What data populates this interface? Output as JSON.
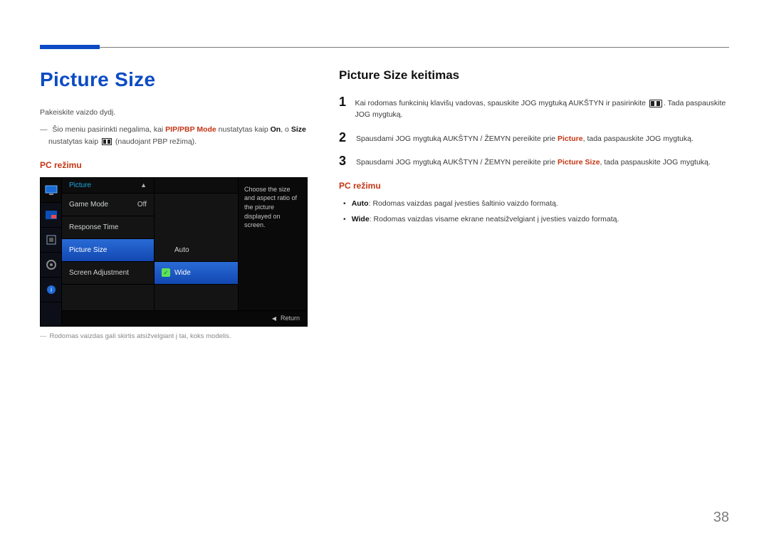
{
  "page_number": 38,
  "left": {
    "title": "Picture Size",
    "intro": "Pakeiskite vaizdo dydį.",
    "note_parts": {
      "a": "Šio meniu pasirinkti negalima, kai ",
      "b": "PIP/PBP Mode",
      "c": " nustatytas kaip ",
      "d": "On",
      "e": ", o ",
      "f": "Size",
      "g": " nustatytas kaip ",
      "h": " (naudojant PBP režimą)."
    },
    "pc_mode_label": "PC režimu",
    "footnote": "Rodomas vaizdas gali skirtis atsižvelgiant į tai, koks modelis."
  },
  "osd": {
    "header": "Picture",
    "rows": {
      "game_mode": {
        "label": "Game Mode",
        "value": "Off"
      },
      "response_time": {
        "label": "Response Time"
      },
      "picture_size": {
        "label": "Picture Size"
      },
      "screen_adjustment": {
        "label": "Screen Adjustment"
      }
    },
    "options": {
      "auto": "Auto",
      "wide": "Wide"
    },
    "help": "Choose the size and aspect ratio of the picture displayed on screen.",
    "return": "Return"
  },
  "right": {
    "section_title": "Picture Size keitimas",
    "steps": {
      "s1": {
        "a": "Kai rodomas funkcinių klavišų vadovas, spauskite JOG mygtuką AUKŠTYN ir pasirinkite ",
        "b": ". Tada paspauskite JOG mygtuką."
      },
      "s2": {
        "a": "Spausdami JOG mygtuką AUKŠTYN / ŽEMYN pereikite prie ",
        "hl": "Picture",
        "b": ", tada paspauskite JOG mygtuką."
      },
      "s3": {
        "a": "Spausdami JOG mygtuką AUKŠTYN / ŽEMYN pereikite prie ",
        "hl": "Picture Size",
        "b": ", tada paspauskite JOG mygtuką."
      }
    },
    "pc_mode_label": "PC režimu",
    "bullets": {
      "auto": {
        "hl": "Auto",
        "rest": ": Rodomas vaizdas pagal įvesties šaltinio vaizdo formatą."
      },
      "wide": {
        "hl": "Wide",
        "rest": ": Rodomas vaizdas visame ekrane neatsižvelgiant į įvesties vaizdo formatą."
      }
    }
  }
}
